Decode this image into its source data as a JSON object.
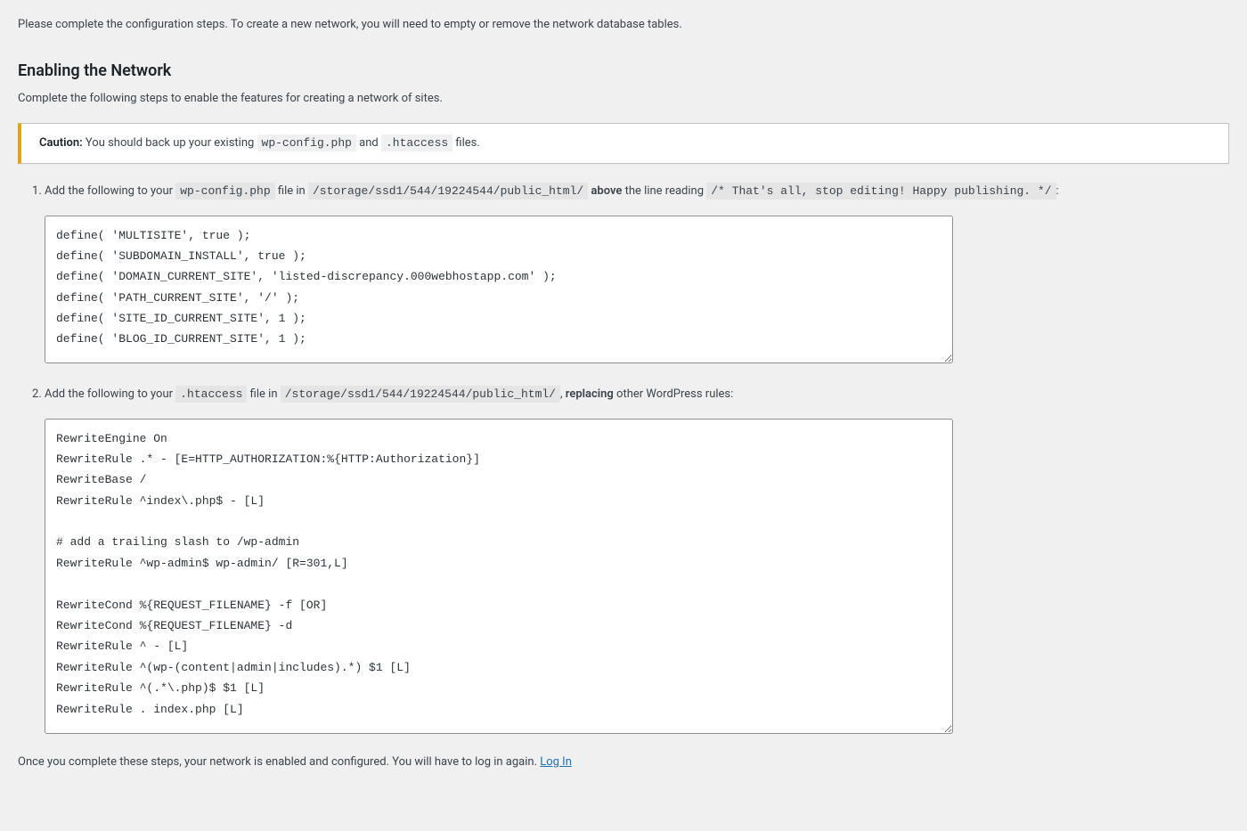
{
  "intro": "Please complete the configuration steps. To create a new network, you will need to empty or remove the network database tables.",
  "heading": "Enabling the Network",
  "heading_desc": "Complete the following steps to enable the features for creating a network of sites.",
  "notice": {
    "prefix": "Caution:",
    "text_before": " You should back up your existing ",
    "file1": "wp-config.php",
    "between": " and ",
    "file2": ".htaccess",
    "text_after": " files."
  },
  "step1": {
    "pre": "Add the following to your ",
    "file": "wp-config.php",
    "mid1": " file in ",
    "path": "/storage/ssd1/544/19224544/public_html/",
    "mid2": " ",
    "above_word": "above",
    "mid3": " the line reading ",
    "comment": "/* That's all, stop editing! Happy publishing. */",
    "end": ":",
    "code": "define( 'MULTISITE', true );\ndefine( 'SUBDOMAIN_INSTALL', true );\ndefine( 'DOMAIN_CURRENT_SITE', 'listed-discrepancy.000webhostapp.com' );\ndefine( 'PATH_CURRENT_SITE', '/' );\ndefine( 'SITE_ID_CURRENT_SITE', 1 );\ndefine( 'BLOG_ID_CURRENT_SITE', 1 );"
  },
  "step2": {
    "pre": "Add the following to your ",
    "file": ".htaccess",
    "mid1": " file in ",
    "path": "/storage/ssd1/544/19224544/public_html/",
    "mid2": ", ",
    "replacing_word": "replacing",
    "end": " other WordPress rules:",
    "code": "RewriteEngine On\nRewriteRule .* - [E=HTTP_AUTHORIZATION:%{HTTP:Authorization}]\nRewriteBase /\nRewriteRule ^index\\.php$ - [L]\n\n# add a trailing slash to /wp-admin\nRewriteRule ^wp-admin$ wp-admin/ [R=301,L]\n\nRewriteCond %{REQUEST_FILENAME} -f [OR]\nRewriteCond %{REQUEST_FILENAME} -d\nRewriteRule ^ - [L]\nRewriteRule ^(wp-(content|admin|includes).*) $1 [L]\nRewriteRule ^(.*\\.php)$ $1 [L]\nRewriteRule . index.php [L]"
  },
  "outro": {
    "text": "Once you complete these steps, your network is enabled and configured. You will have to log in again. ",
    "link_label": "Log In"
  }
}
